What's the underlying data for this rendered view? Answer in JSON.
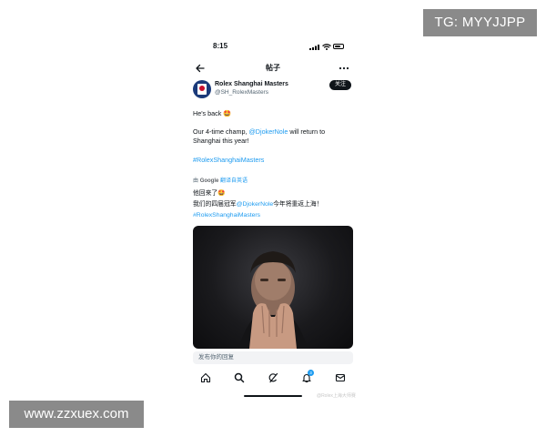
{
  "watermarks": {
    "top_right": "TG: MYYJJPP",
    "bottom_left": "www.zzxuex.com"
  },
  "status_bar": {
    "time": "8:15"
  },
  "nav": {
    "title": "帖子"
  },
  "post": {
    "author_name": "Rolex Shanghai Masters",
    "author_handle": "@SH_RolexMasters",
    "follow_label": "关注",
    "line1": "He's back 🤩",
    "line2_pre": "Our 4-time champ, ",
    "line2_mention": "@DjokerNole",
    "line2_post": " will return to Shanghai this year!",
    "hashtag": "#RolexShanghaiMasters",
    "translation": {
      "by": "由",
      "google": "Google",
      "translated_from": "翻译自英语",
      "line1": "他回来了🤩",
      "line2_pre": "我们的四届冠军",
      "line2_mention": "@DjokerNole",
      "line2_post": "今年将重返上海！",
      "hashtag": "#RolexShanghaiMasters"
    }
  },
  "reply": {
    "placeholder": "发布你的回复"
  },
  "tabbar": {
    "notification_count": "3",
    "icons": [
      "home-icon",
      "search-icon",
      "grok-icon",
      "notifications-icon",
      "messages-icon"
    ]
  },
  "colors": {
    "link": "#1d9bf0",
    "text": "#0f1419",
    "secondary": "#536471"
  },
  "credit": "@Rolex上海大师赛"
}
